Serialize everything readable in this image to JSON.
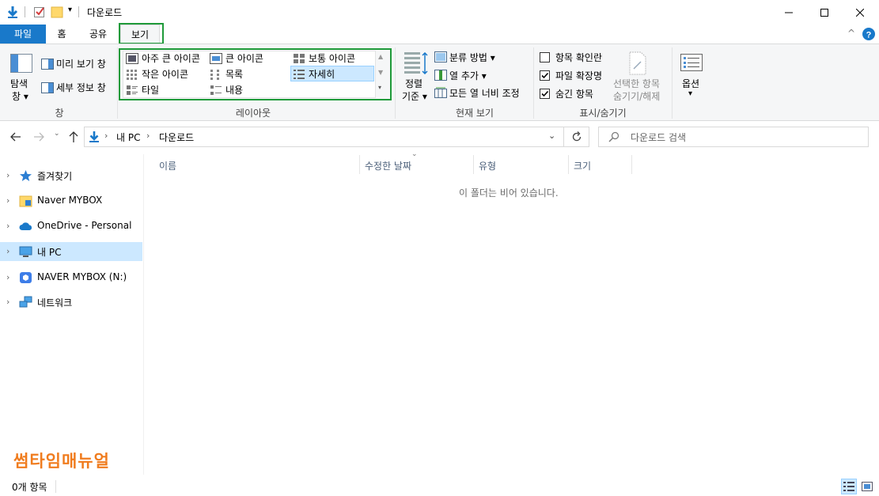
{
  "title": "다운로드",
  "tabs": [
    {
      "label": "파일"
    },
    {
      "label": "홈"
    },
    {
      "label": "공유"
    },
    {
      "label": "보기"
    }
  ],
  "ribbon": {
    "pane_group": {
      "nav_pane_label_1": "탐색",
      "nav_pane_label_2": "창",
      "preview_pane": "미리 보기 창",
      "details_pane": "세부 정보 창",
      "group_label": "창"
    },
    "layout_group": {
      "extra_large": "아주 큰 아이콘",
      "large": "큰 아이콘",
      "medium": "보통 아이콘",
      "small": "작은 아이콘",
      "list": "목록",
      "details": "자세히",
      "tiles": "타일",
      "content": "내용",
      "group_label": "레이아웃"
    },
    "current_view_group": {
      "sort_by_1": "정렬",
      "sort_by_2": "기준",
      "group_by": "분류 방법",
      "add_columns": "열 추가",
      "size_all_columns": "모든 열 너비 조정",
      "group_label": "현재 보기"
    },
    "show_hide_group": {
      "item_checkboxes": "항목 확인란",
      "item_checkboxes_checked": false,
      "file_extensions": "파일 확장명",
      "file_extensions_checked": true,
      "hidden_items": "숨긴 항목",
      "hidden_items_checked": true,
      "hide_selected_1": "선택한 항목",
      "hide_selected_2": "숨기기/해제",
      "group_label": "표시/숨기기"
    },
    "options_label": "옵션"
  },
  "address": {
    "crumbs": [
      "내 PC",
      "다운로드"
    ],
    "search_placeholder": "다운로드 검색"
  },
  "nav_pane": [
    {
      "label": "즐겨찾기",
      "icon": "star-icon"
    },
    {
      "label": "Naver MYBOX",
      "icon": "folder-icon"
    },
    {
      "label": "OneDrive - Personal",
      "icon": "cloud-icon"
    },
    {
      "label": "내 PC",
      "icon": "computer-icon",
      "selected": true
    },
    {
      "label": "NAVER MYBOX (N:)",
      "icon": "drive-icon"
    },
    {
      "label": "네트워크",
      "icon": "network-icon"
    }
  ],
  "columns": [
    {
      "label": "이름"
    },
    {
      "label": "수정한 날짜"
    },
    {
      "label": "유형"
    },
    {
      "label": "크기"
    }
  ],
  "empty_message": "이 폴더는 비어 있습니다.",
  "watermark": "썸타임매뉴얼",
  "status_text": "0개 항목",
  "colors": {
    "accent": "#1979ca",
    "highlight_box": "#1f9a3a",
    "watermark": "#f07c1e",
    "selected_bg": "#cce8ff"
  }
}
